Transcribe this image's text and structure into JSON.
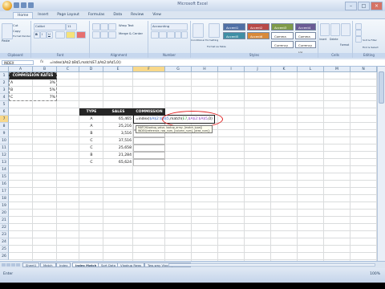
{
  "window": {
    "title": "Microsoft Excel"
  },
  "tabs": [
    "Home",
    "Insert",
    "Page Layout",
    "Formulas",
    "Data",
    "Review",
    "View"
  ],
  "ribbon": {
    "groups": [
      "Clipboard",
      "Font",
      "Alignment",
      "Number",
      "Styles",
      "Cells",
      "Editing"
    ],
    "clipboard": {
      "paste": "Paste",
      "cut": "Cut",
      "copy": "Copy",
      "format_painter": "Format Painter"
    },
    "font": {
      "name": "Calibri",
      "size": "11"
    },
    "alignment": {
      "wrap": "Wrap Text",
      "merge": "Merge & Center"
    },
    "number": {
      "format": "Accounting"
    },
    "styles": {
      "conditional": "Conditional Formatting",
      "format_table": "Format as Table",
      "chips": [
        "Accent1",
        "Accent2",
        "Accent3",
        "Accent4",
        "Accent5",
        "Accent6",
        "Comma",
        "Comma [0]",
        "Currency",
        "Currency [0]"
      ]
    },
    "cells": {
      "insert": "Insert",
      "delete": "Delete",
      "format": "Format"
    },
    "editing": {
      "sort": "Sort & Filter",
      "find": "Find & Select"
    }
  },
  "formula_bar": {
    "name_box": "INDEX",
    "fx": "fx",
    "formula": "=index($A$2:$B$5,match(E7,$A$2:$A$5,0))"
  },
  "columns": [
    "A",
    "B",
    "C",
    "D",
    "E",
    "F",
    "G",
    "H",
    "I",
    "J",
    "K",
    "L",
    "M",
    "N"
  ],
  "rows": [
    "1",
    "2",
    "3",
    "4",
    "5",
    "6",
    "7",
    "8",
    "9",
    "10",
    "11",
    "12",
    "13",
    "14",
    "15",
    "16",
    "17",
    "18",
    "19",
    "20",
    "21",
    "22",
    "23",
    "24",
    "25",
    "26"
  ],
  "rates_table": {
    "header": "COMMISSION RATES",
    "rows": [
      {
        "type": "A",
        "rate": "3%"
      },
      {
        "type": "B",
        "rate": "5%"
      },
      {
        "type": "C",
        "rate": "7%"
      }
    ]
  },
  "sales_table": {
    "headers": [
      "TYPE",
      "SALES",
      "COMMISSION"
    ],
    "rows": [
      {
        "type": "A",
        "sales": "65,465"
      },
      {
        "type": "A",
        "sales": "25,216"
      },
      {
        "type": "B",
        "sales": "3,516"
      },
      {
        "type": "C",
        "sales": "37,516"
      },
      {
        "type": "C",
        "sales": "25,658"
      },
      {
        "type": "B",
        "sales": "21,284"
      },
      {
        "type": "C",
        "sales": "65,624"
      }
    ]
  },
  "editing_cell": {
    "part1": "=index(",
    "part2": "$A$2:$B$5",
    "part3": ",match(",
    "part4": "E7",
    "part5": ",",
    "part6": "$A$2:$A$5",
    "part7": ",0)"
  },
  "tooltip": {
    "line1": "MATCH(lookup_value, lookup_array, [match_type])",
    "line2": "INDEX(reference, row_num, [column_num], [area_num])"
  },
  "sheet_tabs": [
    "Sheet1",
    "Match",
    "Index",
    "Index Match",
    "Sort Data",
    "Vlookup Rows",
    "Two-way Vlookup",
    "Tables"
  ],
  "active_sheet": "Index Match",
  "status": {
    "mode": "Enter",
    "zoom": "100%"
  }
}
